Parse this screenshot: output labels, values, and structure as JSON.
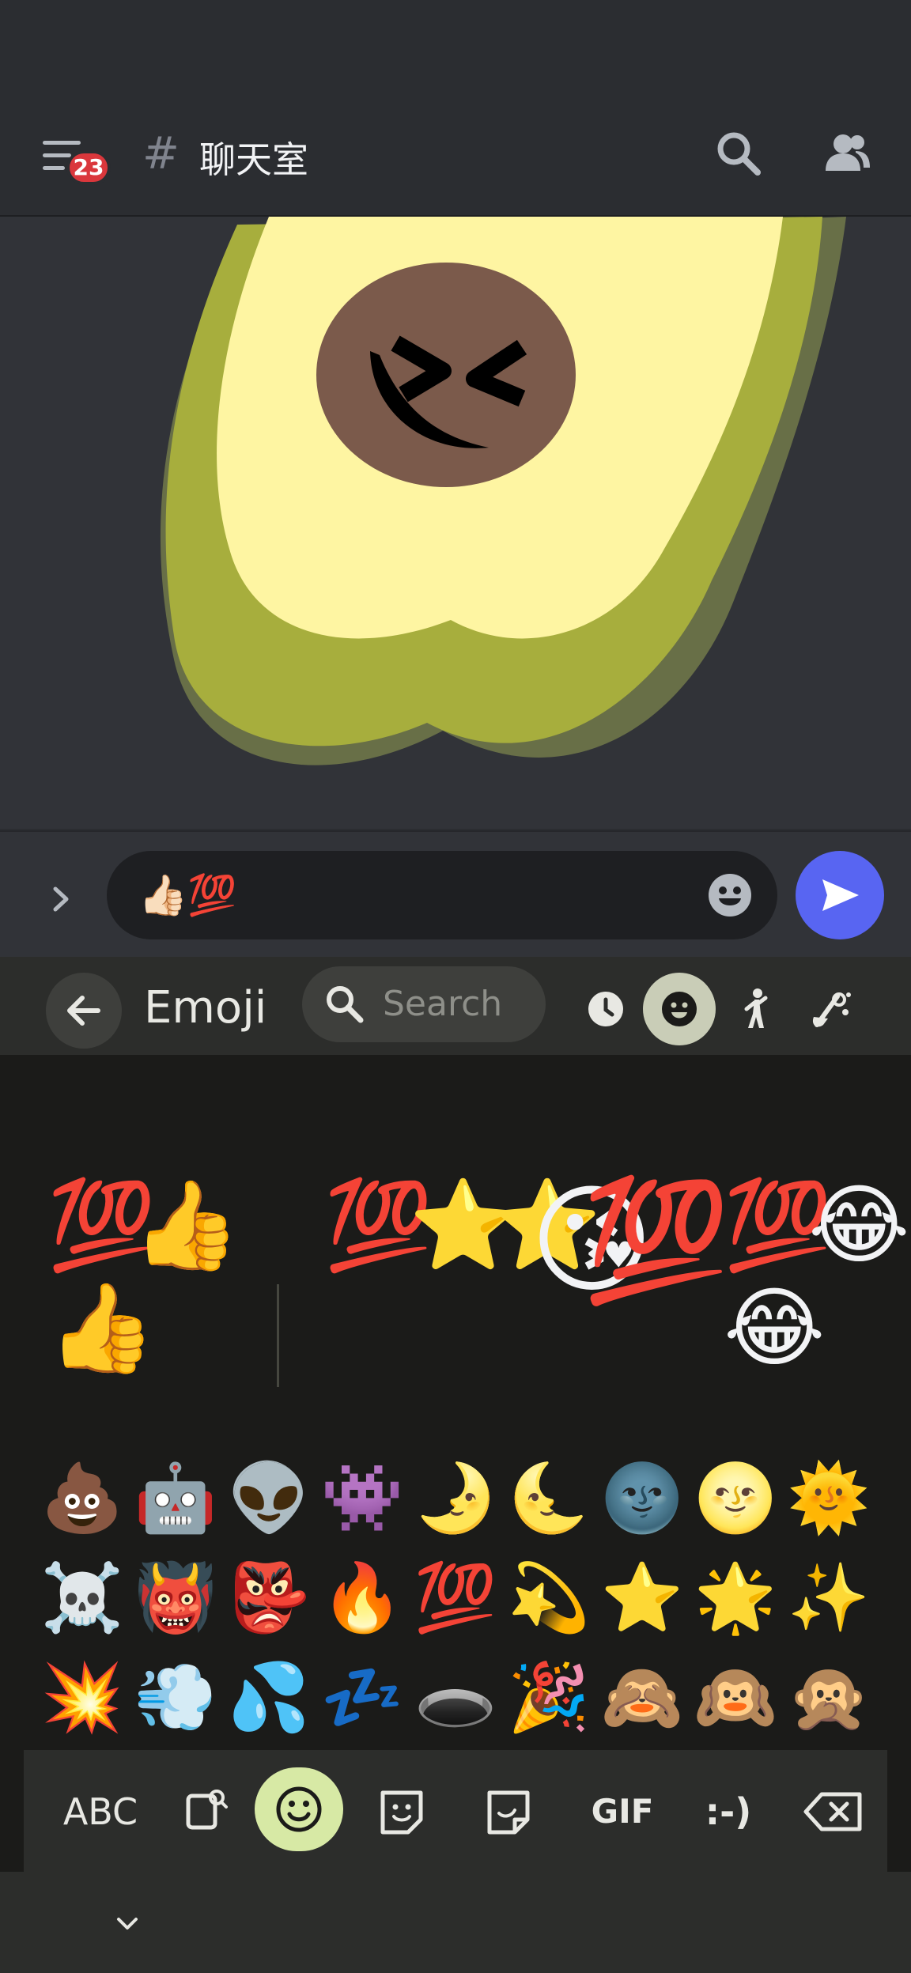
{
  "header": {
    "badge_count": "23",
    "hash_symbol": "#",
    "channel_name": "聊天室"
  },
  "composer": {
    "input_value": "👍🏻💯"
  },
  "keyboard": {
    "title": "Emoji",
    "search_placeholder": "Search",
    "suggestions": [
      "💯👍👍",
      "💯⭐⭐",
      "😘💯",
      "💯😂😂"
    ],
    "grid_rows": [
      [
        "💩",
        "🤖",
        "👽",
        "👾",
        "🌛",
        "🌜",
        "🌚",
        "🌝",
        "🌞"
      ],
      [
        "☠️",
        "👹",
        "👺",
        "🔥",
        "💯",
        "💫",
        "⭐",
        "🌟",
        "✨"
      ],
      [
        "💥",
        "💨",
        "💦",
        "💤",
        "🕳️",
        "🎉",
        "🙈",
        "🙉",
        "🙊"
      ],
      [
        "😺",
        "😸",
        "😹",
        "😻",
        "😼",
        "😽",
        "🙀",
        "😿",
        "😾"
      ],
      [
        "❤️",
        "🧡",
        "💛",
        "💚",
        "💙",
        "💙",
        "💜",
        "🤎",
        "🖤"
      ]
    ],
    "bottom_bar": {
      "abc_label": "ABC",
      "gif_label": "GIF",
      "emoticon_label": ":-)"
    }
  }
}
